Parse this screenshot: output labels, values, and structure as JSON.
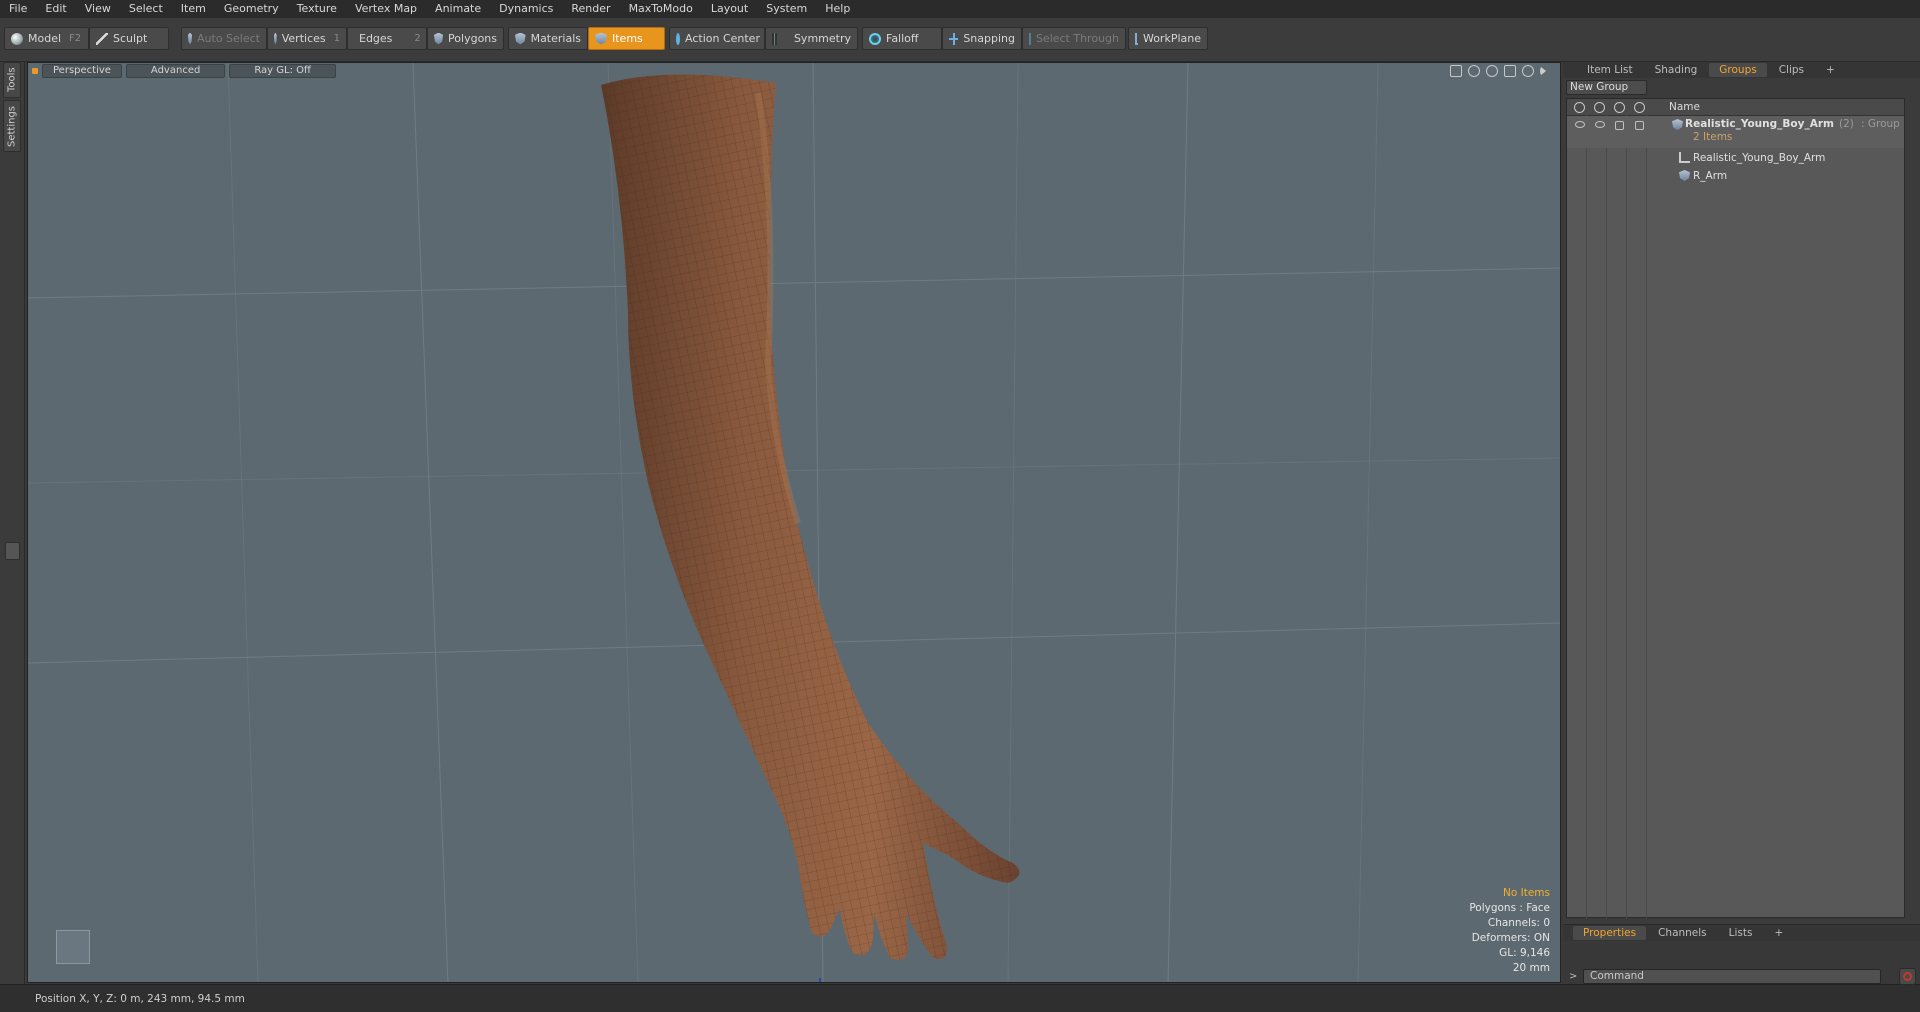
{
  "menu": [
    "File",
    "Edit",
    "View",
    "Select",
    "Item",
    "Geometry",
    "Texture",
    "Vertex Map",
    "Animate",
    "Dynamics",
    "Render",
    "MaxToModo",
    "Layout",
    "System",
    "Help"
  ],
  "toolbar": {
    "model_label": "Model",
    "model_key": "F2",
    "sculpt_label": "Sculpt",
    "auto_select_label": "Auto Select",
    "vertices_label": "Vertices",
    "vertices_key": "1",
    "edges_label": "Edges",
    "edges_key": "2",
    "polygons_label": "Polygons",
    "materials_label": "Materials",
    "items_label": "Items",
    "action_center_label": "Action Center",
    "symmetry_label": "Symmetry",
    "falloff_label": "Falloff",
    "snapping_label": "Snapping",
    "select_through_label": "Select Through",
    "workplane_label": "WorkPlane",
    "active_color": "#e8951e"
  },
  "left_tabs": {
    "tools": "Tools",
    "settings": "Settings"
  },
  "viewport": {
    "tabs": [
      "Perspective",
      "Advanced",
      "Ray GL: Off"
    ],
    "background": "#5d6970",
    "info": {
      "no_items": "No Items",
      "polygons": "Polygons : Face",
      "channels": "Channels: 0",
      "deformers": "Deformers: ON",
      "gl": "GL: 9,146",
      "scale": "20 mm"
    }
  },
  "status": {
    "position": "Position X, Y, Z:  0 m, 243 mm, 94.5 mm"
  },
  "right_panel": {
    "tabs": [
      "Item List",
      "Shading",
      "Groups",
      "Clips",
      "+"
    ],
    "active_tab": "Groups",
    "new_group_label": "New Group",
    "column_name": "Name",
    "group": {
      "name": "Realistic_Young_Boy_Arm",
      "count": "(2)",
      "type": ": Group",
      "sub": "2 Items"
    },
    "items": [
      "Realistic_Young_Boy_Arm",
      "R_Arm"
    ]
  },
  "bottom_panel": {
    "tabs": [
      "Properties",
      "Channels",
      "Lists",
      "+"
    ],
    "active_tab": "Properties",
    "command_placeholder": "Command"
  }
}
